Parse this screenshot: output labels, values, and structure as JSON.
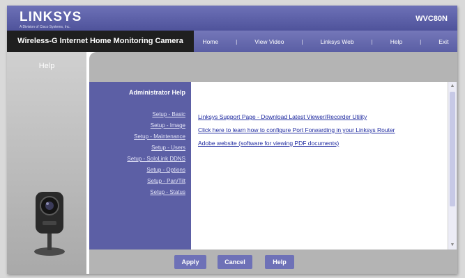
{
  "header": {
    "brand": "LINKSYS",
    "brand_sub": "A Division of Cisco Systems, Inc.",
    "model": "WVC80N"
  },
  "navbar": {
    "product_title": "Wireless-G Internet Home Monitoring Camera",
    "menu": [
      "Home",
      "View Video",
      "Linksys Web",
      "Help",
      "Exit"
    ]
  },
  "sidebar": {
    "title": "Help"
  },
  "help_panel": {
    "title": "Administrator Help",
    "links": [
      "Setup - Basic",
      "Setup - Image",
      "Setup - Maintenance",
      "Setup - Users",
      "Setup - SoloLink DDNS",
      "Setup - Options",
      "Setup - Pan/Tilt",
      "Setup - Status"
    ]
  },
  "main": {
    "links": [
      "Linksys Support Page - Download Latest Viewer/Recorder Utility",
      "Click here to learn how to configure Port Forwarding in your Linksys Router",
      "Adobe website (software for viewing PDF documents)"
    ]
  },
  "footer": {
    "apply": "Apply",
    "cancel": "Cancel",
    "help": "Help"
  },
  "colors": {
    "accent": "#5c5fa5",
    "link": "#1f2aa0",
    "panel_gray": "#b4b4b4"
  }
}
